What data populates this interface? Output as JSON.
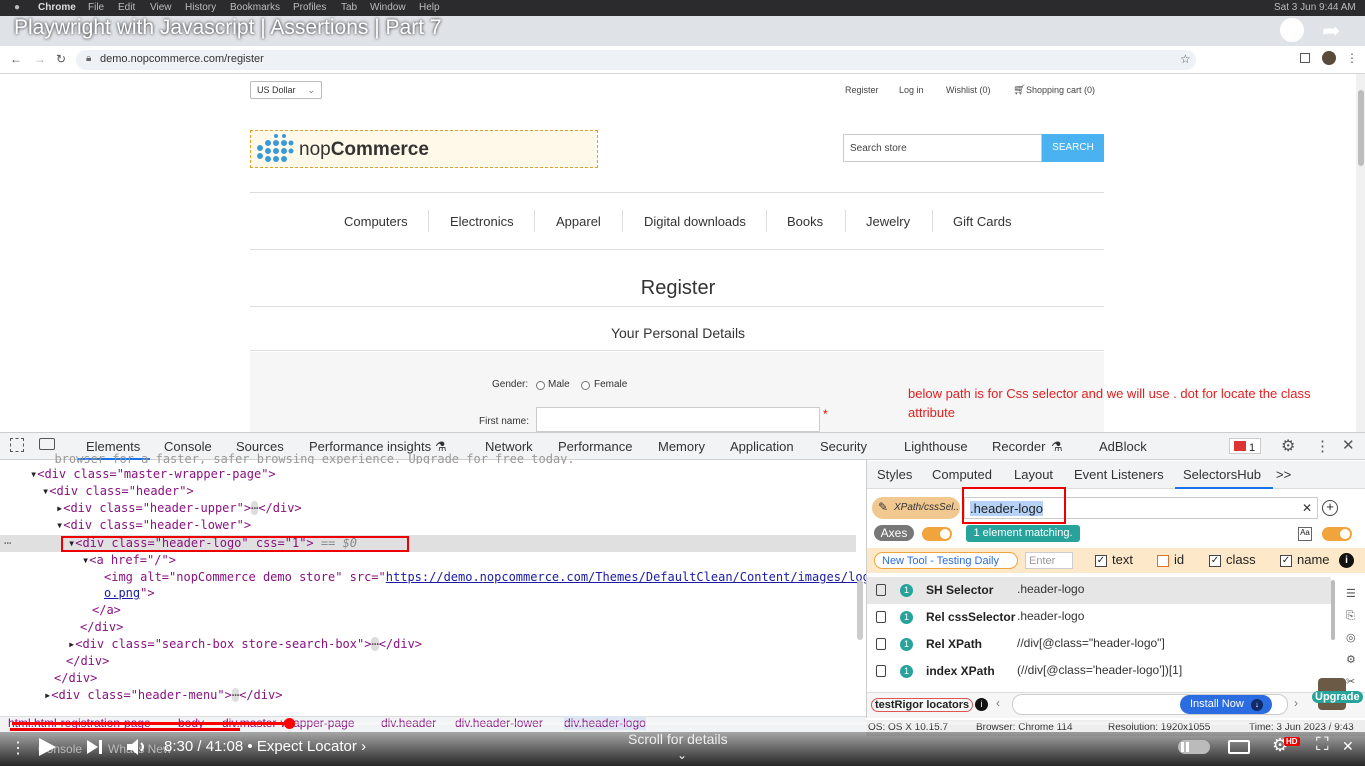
{
  "mac_menu": {
    "apple": "",
    "app": "Chrome",
    "items": [
      "File",
      "Edit",
      "View",
      "History",
      "Bookmarks",
      "Profiles",
      "Tab",
      "Window",
      "Help"
    ],
    "datetime": "Sat 3 Jun  9:44 AM"
  },
  "video": {
    "title": "Playwright with Javascript | Assertions | Part 7",
    "time": "8:30 / 41:08",
    "chapter": "Expect Locator",
    "scroll_hint": "Scroll for details",
    "progress_fraction": 0.2067,
    "hd_badge": "HD"
  },
  "browser": {
    "url": "demo.nopcommerce.com/register"
  },
  "site": {
    "currency": "US Dollar",
    "header_links": [
      "Register",
      "Log in",
      "Wishlist (0)",
      "Shopping cart (0)"
    ],
    "logo_text_light": "nop",
    "logo_text_bold": "Commerce",
    "search_placeholder": "Search store",
    "search_button": "SEARCH",
    "nav": [
      "Computers",
      "Electronics",
      "Apparel",
      "Digital downloads",
      "Books",
      "Jewelry",
      "Gift Cards"
    ],
    "page_title": "Register",
    "section_title": "Your Personal Details",
    "gender_label": "Gender:",
    "gender_options": [
      "Male",
      "Female"
    ],
    "first_name_label": "First name:",
    "required_mark": "*"
  },
  "annotation": "below path is for Css selector and we will use . dot for locate the class attribute",
  "devtools": {
    "tabs": [
      "Elements",
      "Console",
      "Sources",
      "Performance insights",
      "Network",
      "Performance",
      "Memory",
      "Application",
      "Security",
      "Lighthouse",
      "Recorder",
      "AdBlock"
    ],
    "error_count": "1",
    "code_lines": {
      "l0": "  browser for a faster, safer browsing experience. Upgrade for free today.",
      "l1_tag": "<div class=\"master-wrapper-page\">",
      "l2_tag": "<div class=\"header\">",
      "l3_tag": "<div class=\"header-upper\">",
      "l3_end": "</div>",
      "l4_tag": "<div class=\"header-lower\">",
      "l5_tag": "<div class=\"header-logo\" css=\"1\">",
      "l5_eq": "== $0",
      "l6_tag": "<a href=\"/\">",
      "l7_tag": "<img alt=\"nopCommerce demo store\" src=\"",
      "l7_link": "https://demo.nopcommerce.com/Themes/DefaultClean/Content/images/log",
      "l8_link": "o.png",
      "l8_tag": "\">",
      "l9_tag": "</a>",
      "l10_tag": "</div>",
      "l11_tag": "<div class=\"search-box store-search-box\">",
      "l11_end": "</div>",
      "l12_tag": "</div>",
      "l13_tag": "</div>",
      "l14_tag": "<div class=\"header-menu\">",
      "l14_end": "</div>",
      "ellipsis": "⋯"
    },
    "breadcrumbs": [
      "html.html-registration-page",
      "body",
      "div.master-wrapper-page",
      "div.header",
      "div.header-lower",
      "div.header-logo"
    ],
    "drawer_tabs": [
      "Console",
      "What's New"
    ],
    "right_tabs": [
      "Styles",
      "Computed",
      "Layout",
      "Event Listeners",
      "SelectorsHub"
    ],
    "more_tabs": ">>"
  },
  "selectorshub": {
    "xpath_button": "XPath/cssSel..",
    "selector_value": ".header-logo",
    "axes_label": "Axes",
    "match_text": "1 element matching.",
    "new_tool": "New Tool - Testing Daily",
    "enter_placeholder": "Enter",
    "checkboxes": [
      {
        "label": "text",
        "checked": true
      },
      {
        "label": "id",
        "checked": false
      },
      {
        "label": "class",
        "checked": true
      },
      {
        "label": "name",
        "checked": true
      }
    ],
    "results": [
      {
        "count": "1",
        "label": "SH Selector",
        "value": ".header-logo"
      },
      {
        "count": "1",
        "label": "Rel cssSelector",
        "value": ".header-logo"
      },
      {
        "count": "1",
        "label": "Rel XPath",
        "value": "//div[@class=\"header-logo\"]"
      },
      {
        "count": "1",
        "label": "index XPath",
        "value": "(//div[@class='header-logo'])[1]"
      }
    ],
    "testrigor": "testRigor locators",
    "install_now": "Install Now",
    "upgrade": "Upgrade",
    "status": {
      "os": "OS: OS X 10.15.7",
      "browser": "Browser: Chrome 114",
      "resolution": "Resolution: 1920x1055",
      "time": "Time: 3 Jun 2023 / 9:43"
    }
  },
  "colors": {
    "accent": "#4ab2f1",
    "annotation": "#e02020",
    "highlight_box": "#ee0000",
    "sh_teal": "#27a39b",
    "sh_orange": "#f1a33c"
  }
}
